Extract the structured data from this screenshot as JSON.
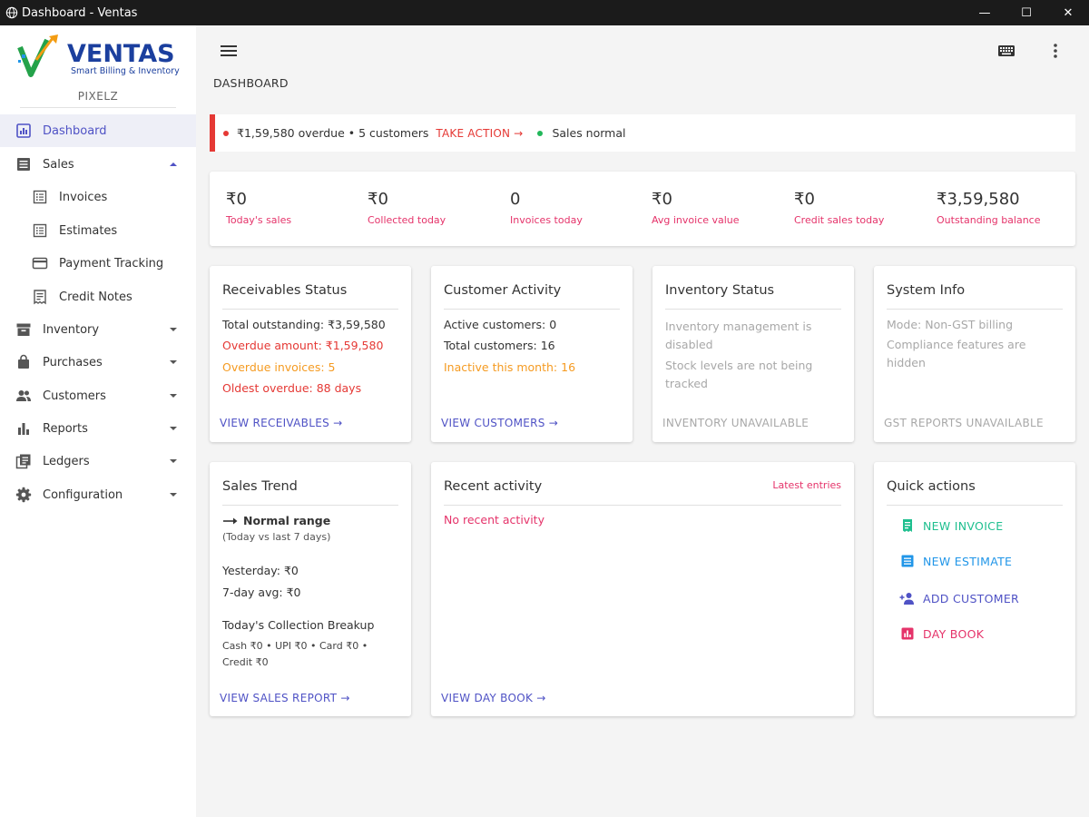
{
  "window": {
    "title": "Dashboard - Ventas",
    "minimize": "—",
    "maximize": "☐",
    "close": "✕"
  },
  "brand": {
    "name": "VENTAS",
    "tagline": "Smart Billing & Inventory",
    "company": "PIXELZ"
  },
  "sidebar": {
    "items": [
      {
        "label": "Dashboard",
        "icon": "dashboard-icon"
      },
      {
        "label": "Sales",
        "icon": "sales-icon"
      },
      {
        "label": "Invoices",
        "icon": "invoice-icon"
      },
      {
        "label": "Estimates",
        "icon": "estimate-icon"
      },
      {
        "label": "Payment Tracking",
        "icon": "card-icon"
      },
      {
        "label": "Credit Notes",
        "icon": "credit-note-icon"
      },
      {
        "label": "Inventory",
        "icon": "inventory-icon"
      },
      {
        "label": "Purchases",
        "icon": "purchases-icon"
      },
      {
        "label": "Customers",
        "icon": "customers-icon"
      },
      {
        "label": "Reports",
        "icon": "reports-icon"
      },
      {
        "label": "Ledgers",
        "icon": "ledgers-icon"
      },
      {
        "label": "Configuration",
        "icon": "gear-icon"
      }
    ]
  },
  "header": {
    "page_title": "DASHBOARD"
  },
  "alert": {
    "overdue_text": "₹1,59,580 overdue • 5 customers",
    "action": "TAKE ACTION →",
    "status": "Sales normal"
  },
  "kpis": [
    {
      "value": "₹0",
      "label": "Today's sales"
    },
    {
      "value": "₹0",
      "label": "Collected today"
    },
    {
      "value": "0",
      "label": "Invoices today"
    },
    {
      "value": "₹0",
      "label": "Avg invoice value"
    },
    {
      "value": "₹0",
      "label": "Credit sales today"
    },
    {
      "value": "₹3,59,580",
      "label": "Outstanding balance"
    }
  ],
  "receivables": {
    "title": "Receivables Status",
    "total": "Total outstanding: ₹3,59,580",
    "overdue_amount": "Overdue amount: ₹1,59,580",
    "overdue_invoices": "Overdue invoices: 5",
    "oldest": "Oldest overdue: 88 days",
    "link": "VIEW RECEIVABLES →"
  },
  "customer_activity": {
    "title": "Customer Activity",
    "active": "Active customers: 0",
    "total": "Total customers: 16",
    "inactive": "Inactive this month: 16",
    "link": "VIEW CUSTOMERS →"
  },
  "inventory_status": {
    "title": "Inventory Status",
    "line1": "Inventory management is disabled",
    "line2": "Stock levels are not being tracked",
    "footer": "INVENTORY UNAVAILABLE"
  },
  "system_info": {
    "title": "System Info",
    "mode": "Mode: Non-GST billing",
    "compliance": "Compliance features are hidden",
    "footer": "GST REPORTS UNAVAILABLE"
  },
  "sales_trend": {
    "title": "Sales Trend",
    "status": "Normal range",
    "subtitle": "(Today vs last 7 days)",
    "yesterday": "Yesterday: ₹0",
    "avg": "7-day avg: ₹0",
    "breakup_title": "Today's Collection Breakup",
    "breakup": "Cash ₹0 • UPI ₹0 • Card ₹0 • Credit ₹0",
    "link": "VIEW SALES REPORT →"
  },
  "recent_activity": {
    "title": "Recent activity",
    "tag": "Latest entries",
    "empty": "No recent activity",
    "link": "VIEW DAY BOOK →"
  },
  "quick_actions": {
    "title": "Quick actions",
    "items": [
      {
        "label": "NEW INVOICE",
        "color": "#1fbf8f"
      },
      {
        "label": "NEW ESTIMATE",
        "color": "#2196e8"
      },
      {
        "label": "ADD CUSTOMER",
        "color": "#4f52c5"
      },
      {
        "label": "DAY BOOK",
        "color": "#e5336a"
      }
    ]
  },
  "colors": {
    "accent": "#4f52c5",
    "danger": "#e53935",
    "warning": "#f59b22",
    "success": "#22b75a",
    "kpi_caption": "#e5336a"
  }
}
